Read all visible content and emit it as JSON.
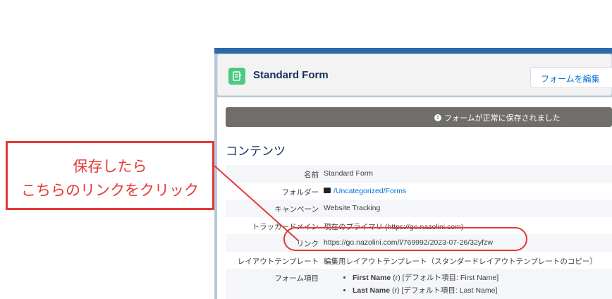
{
  "header": {
    "title": "Standard Form",
    "edit_button": "フォームを編集"
  },
  "toast": {
    "message": "フォームが正常に保存されました"
  },
  "section_title": "コンテンツ",
  "details": [
    {
      "label": "名前",
      "value": "Standard Form"
    },
    {
      "label": "フォルダー",
      "value": "/Uncategorized/Forms"
    },
    {
      "label": "キャンペーン",
      "value": "Website Tracking"
    },
    {
      "label": "トラッカードメイン",
      "value": "現在のプライマリ (https://go.nazolini.com)"
    },
    {
      "label": "リンク",
      "value": "https://go.nazolini.com/l/769992/2023-07-26/32yfzw"
    },
    {
      "label": "レイアウトテンプレート",
      "value": "編集用レイアウトテンプレート（スタンダードレイアウトテンプレートのコピー）"
    },
    {
      "label": "フォーム項目",
      "value": ""
    }
  ],
  "form_fields": [
    {
      "name": "First Name",
      "suffix": "(r) [デフォルト項目: First Name]"
    },
    {
      "name": "Last Name",
      "suffix": "(r) [デフォルト項目: Last Name]"
    }
  ],
  "annotation": {
    "line1": "保存したら",
    "line2": "こちらのリンクをクリック",
    "color": "#e53935"
  },
  "icons": {
    "form": "form-document-icon",
    "info": "info-icon",
    "folder": "folder-icon"
  }
}
